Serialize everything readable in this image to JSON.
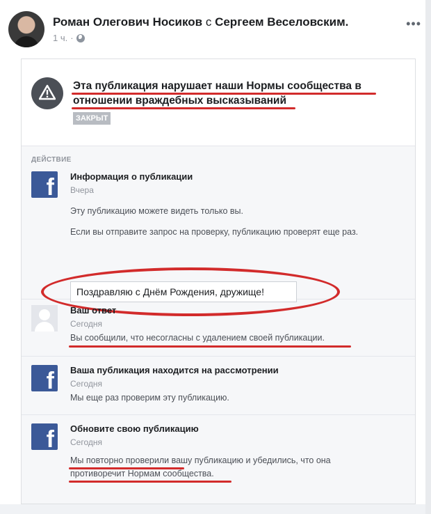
{
  "post": {
    "author": "Роман Олегович Носиков",
    "with_word": "с",
    "tagged": "Сергеем Веселовским.",
    "time": "1 ч.",
    "more_icon": "more-dots-icon",
    "privacy_icon": "globe-icon"
  },
  "banner": {
    "title": "Эта публикация нарушает наши Нормы сообщества в отношении враждебных высказываний",
    "badge": "ЗАКРЫТ",
    "icon": "warning-icon"
  },
  "section_heading": "ДЕЙСТВИЕ",
  "items": [
    {
      "icon": "facebook-logo-icon",
      "title": "Информация о публикации",
      "time": "Вчера",
      "text1": "Эту публикацию можете видеть только вы.",
      "text2": "Если вы отправите запрос на проверку, публикацию проверят еще раз.",
      "quote": "Поздравляю с Днём Рождения, дружище!"
    },
    {
      "icon": "user-placeholder-icon",
      "title": "Ваш ответ",
      "time": "Сегодня",
      "text1": "Вы сообщили, что несогласны с удалением своей публикации."
    },
    {
      "icon": "facebook-logo-icon",
      "title": "Ваша публикация находится на рассмотрении",
      "time": "Сегодня",
      "text1": "Мы еще раз проверим эту публикацию."
    },
    {
      "icon": "facebook-logo-icon",
      "title": "Обновите свою публикацию",
      "time": "Сегодня",
      "text1": "Мы повторно проверили вашу публикацию и убедились, что она противоречит Нормам сообщества."
    }
  ],
  "colors": {
    "facebook_blue": "#3b5998",
    "annotation_red": "#d22b2b",
    "badge_gray": "#b8bcc2"
  }
}
